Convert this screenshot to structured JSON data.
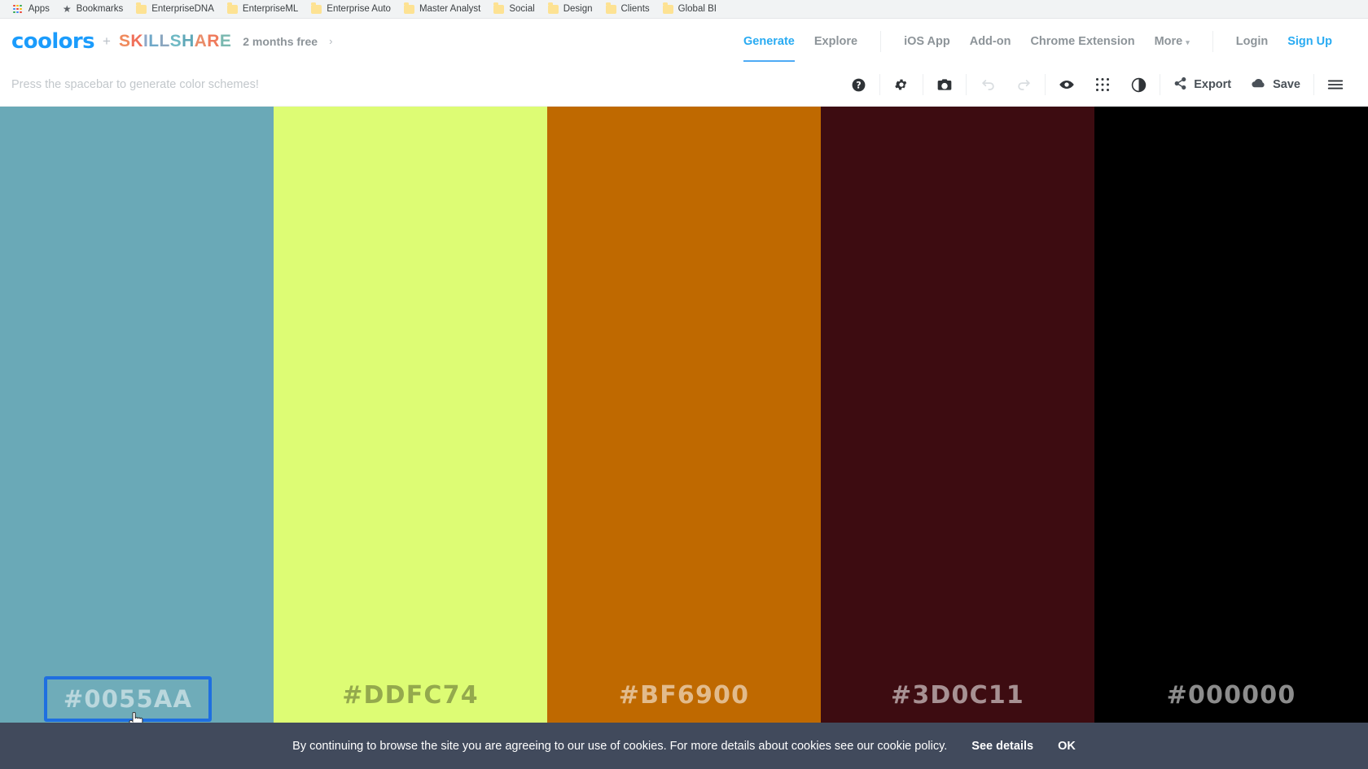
{
  "browser": {
    "bookmarks": [
      {
        "label": "Apps",
        "icon": "apps-grid-icon"
      },
      {
        "label": "Bookmarks",
        "icon": "star-icon"
      },
      {
        "label": "EnterpriseDNA",
        "icon": "folder-icon"
      },
      {
        "label": "EnterpriseML",
        "icon": "folder-icon"
      },
      {
        "label": "Enterprise Auto",
        "icon": "folder-icon"
      },
      {
        "label": "Master Analyst",
        "icon": "folder-icon"
      },
      {
        "label": "Social",
        "icon": "folder-icon"
      },
      {
        "label": "Design",
        "icon": "folder-icon"
      },
      {
        "label": "Clients",
        "icon": "folder-icon"
      },
      {
        "label": "Global BI",
        "icon": "folder-icon"
      }
    ]
  },
  "header": {
    "logo": "coolors",
    "logo_color": "#1b9cfc",
    "plus": "+",
    "partner": "SKILLSHARE",
    "partner_letters": [
      {
        "ch": "S",
        "color": "#f08a5d"
      },
      {
        "ch": "K",
        "color": "#f0705a"
      },
      {
        "ch": "I",
        "color": "#8fa8c8"
      },
      {
        "ch": "L",
        "color": "#6fa8c8"
      },
      {
        "ch": "L",
        "color": "#8aa6bf"
      },
      {
        "ch": "S",
        "color": "#6fb9c4"
      },
      {
        "ch": "H",
        "color": "#5fa8b8"
      },
      {
        "ch": "A",
        "color": "#e98d6a"
      },
      {
        "ch": "R",
        "color": "#ef7b5c"
      },
      {
        "ch": "E",
        "color": "#7ab8b0"
      }
    ],
    "promo": "2 months free",
    "promo_arrow": "›",
    "nav_primary": [
      {
        "label": "Generate",
        "active": true
      },
      {
        "label": "Explore",
        "active": false
      }
    ],
    "nav_secondary": [
      {
        "label": "iOS App"
      },
      {
        "label": "Add-on"
      },
      {
        "label": "Chrome Extension"
      }
    ],
    "more_label": "More",
    "more_caret": "▾",
    "login_label": "Login",
    "signup_label": "Sign Up",
    "accent_color": "#29abf2"
  },
  "toolbar": {
    "hint": "Press the spacebar to generate color schemes!",
    "icons": [
      {
        "name": "help-icon",
        "title": "Help",
        "disabled": false
      },
      {
        "name": "gear-icon",
        "title": "Settings",
        "disabled": false
      },
      {
        "name": "camera-icon",
        "title": "Camera",
        "disabled": false
      },
      {
        "name": "undo-icon",
        "title": "Undo",
        "disabled": true
      },
      {
        "name": "redo-icon",
        "title": "Redo",
        "disabled": true
      },
      {
        "name": "eye-icon",
        "title": "View",
        "disabled": false
      },
      {
        "name": "grid-icon",
        "title": "Grid",
        "disabled": false
      },
      {
        "name": "contrast-icon",
        "title": "Adjust",
        "disabled": false
      }
    ],
    "export_label": "Export",
    "save_label": "Save",
    "menu_icon": "hamburger-menu-icon"
  },
  "palette": {
    "swatches": [
      {
        "hex": "#0055AA",
        "display_color": "#6aa9b7",
        "label_color": "rgba(255,255,255,0.52)",
        "editing": true,
        "focus_border": "#1f6fe0"
      },
      {
        "hex": "#DDFC74",
        "display_color": "#ddfc74",
        "label_color": "rgba(0,0,0,0.33)",
        "editing": false
      },
      {
        "hex": "#BF6900",
        "display_color": "#bf6900",
        "label_color": "rgba(255,255,255,0.55)",
        "editing": false
      },
      {
        "hex": "#3D0C11",
        "display_color": "#3d0c11",
        "label_color": "rgba(255,255,255,0.55)",
        "editing": false
      },
      {
        "hex": "#000000",
        "display_color": "#000000",
        "label_color": "rgba(255,255,255,0.55)",
        "editing": false
      }
    ]
  },
  "cookie_banner": {
    "message": "By continuing to browse the site you are agreeing to our use of cookies. For more details about cookies see our cookie policy.",
    "details_label": "See details",
    "ok_label": "OK",
    "background": "#414a5c"
  }
}
